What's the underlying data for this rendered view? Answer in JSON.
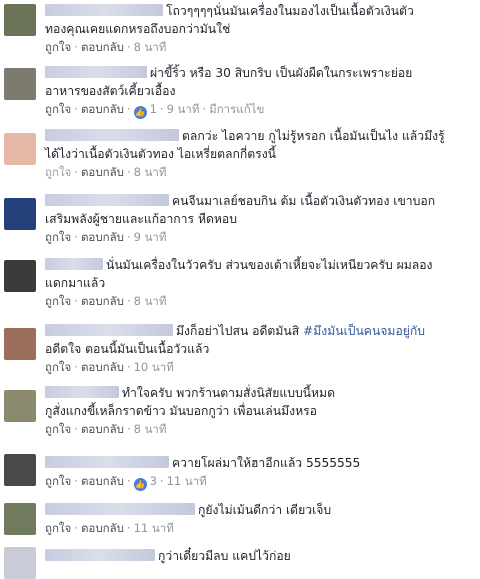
{
  "comments": [
    {
      "lines": [
        "โถวๆๆๆๆนั่นมันเครื่องในมองไงเป็นเนื้อตัวเงินตัว",
        "ทองคุณเคยแดกหรอถึงบอกว่ามันใช่"
      ],
      "like": "ถูกใจ",
      "reply": "ตอบกลับ",
      "time": "8 นาที",
      "avatar_color": "#6b7358"
    },
    {
      "lines": [
        "ผ่าขี้ริ้ว หรือ 30 สิบกริบ เป็นผังผืดในกระเพราะย่อย",
        "อาหารของสัตว์เคี้ยวเอื้อง"
      ],
      "like": "ถูกใจ",
      "reply": "ตอบกลับ",
      "reactions": "1",
      "time": "9 นาที",
      "edited": "มีการแก้ไข",
      "avatar_color": "#7d7a70"
    },
    {
      "lines": [
        "ตลกว่ะ ไอควาย กูไม่รู้หรอก เนื้อมันเป็นไง แล้วมึงรู้",
        "ได้ไงว่าเนื้อตัวเงินตัวทอง ไอเหรี่ยตลกกี่ตรงนี้"
      ],
      "like": "ถูกใจ",
      "reply": "ตอบกลับ",
      "time": "8 นาที",
      "avatar_color": "#e6b9a6"
    },
    {
      "lines": [
        "คนจีนมาเลย์ชอบกิน ต้ม เนื้อตัวเงินตัวทอง เขาบอก",
        "เสริมพลังผู้ชายและแก้อาการ หืดหอบ"
      ],
      "like": "ถูกใจ",
      "reply": "ตอบกลับ",
      "time": "9 นาที",
      "avatar_color": "#23407a"
    },
    {
      "lines": [
        "นั่นมันเครื่องในวัวครับ ส่วนของเต้าเหี้ยจะไม่เหนียวครับ ผมลอง",
        "แดกมาแล้ว"
      ],
      "like": "ถูกใจ",
      "reply": "ตอบกลับ",
      "time": "8 นาที",
      "avatar_color": "#3b3b3b"
    },
    {
      "lines": [
        "มึงก็อย่าไปสน อดีตมันสิ",
        "อดีตใจ ตอนนี้มันเป็นเนื้อวัวแล้ว"
      ],
      "hashtag": "#มึงมันเป็นคนจมอยู่กับ",
      "like": "ถูกใจ",
      "reply": "ตอบกลับ",
      "time": "10 นาที",
      "avatar_color": "#9b6e5c"
    },
    {
      "lines": [
        "ทำใจครับ พวกร้านตามสั่งนิสัยแบบนี้หมด",
        "กูสั่งแกงขี้เหล็กราดข้าว มันบอกกูว่า เพื่อนเล่นมึงหรอ"
      ],
      "like": "ถูกใจ",
      "reply": "ตอบกลับ",
      "time": "8 นาที",
      "avatar_color": "#8c8a6e"
    },
    {
      "lines": [
        "ควายโผล่มาให้ฮาอีกแล้ว 5555555"
      ],
      "like": "ถูกใจ",
      "reply": "ตอบกลับ",
      "reactions": "3",
      "time": "11 นาที",
      "avatar_color": "#4a4a4a"
    },
    {
      "lines": [
        "กูยังไม่เม้นดีกว่า เดียวเจ็บ"
      ],
      "like": "ถูกใจ",
      "reply": "ตอบกลับ",
      "time": "11 นาที",
      "avatar_color": "#6f7a5e"
    },
    {
      "lines": [
        "กูว่าเดี๋ยวมีลบ แคปไว้ก่อย"
      ],
      "avatar_color": "#c9ccd6"
    }
  ]
}
